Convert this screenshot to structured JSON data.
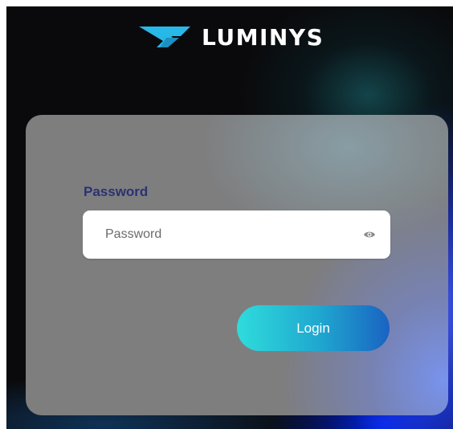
{
  "brand": {
    "logo_icon": "luminys-chevron-logo",
    "name": "LUMINYS",
    "logo_color": "#27b8e8"
  },
  "login_form": {
    "password_label": "Password",
    "password_placeholder": "Password",
    "password_value": "",
    "reveal_icon": "eye-icon",
    "login_button_label": "Login"
  },
  "colors": {
    "label_color": "#2a3273",
    "button_gradient_start": "#2fdcdc",
    "button_gradient_end": "#1a63c2",
    "card_background": "#7e7e7f",
    "page_background": "#0a0a0c"
  }
}
